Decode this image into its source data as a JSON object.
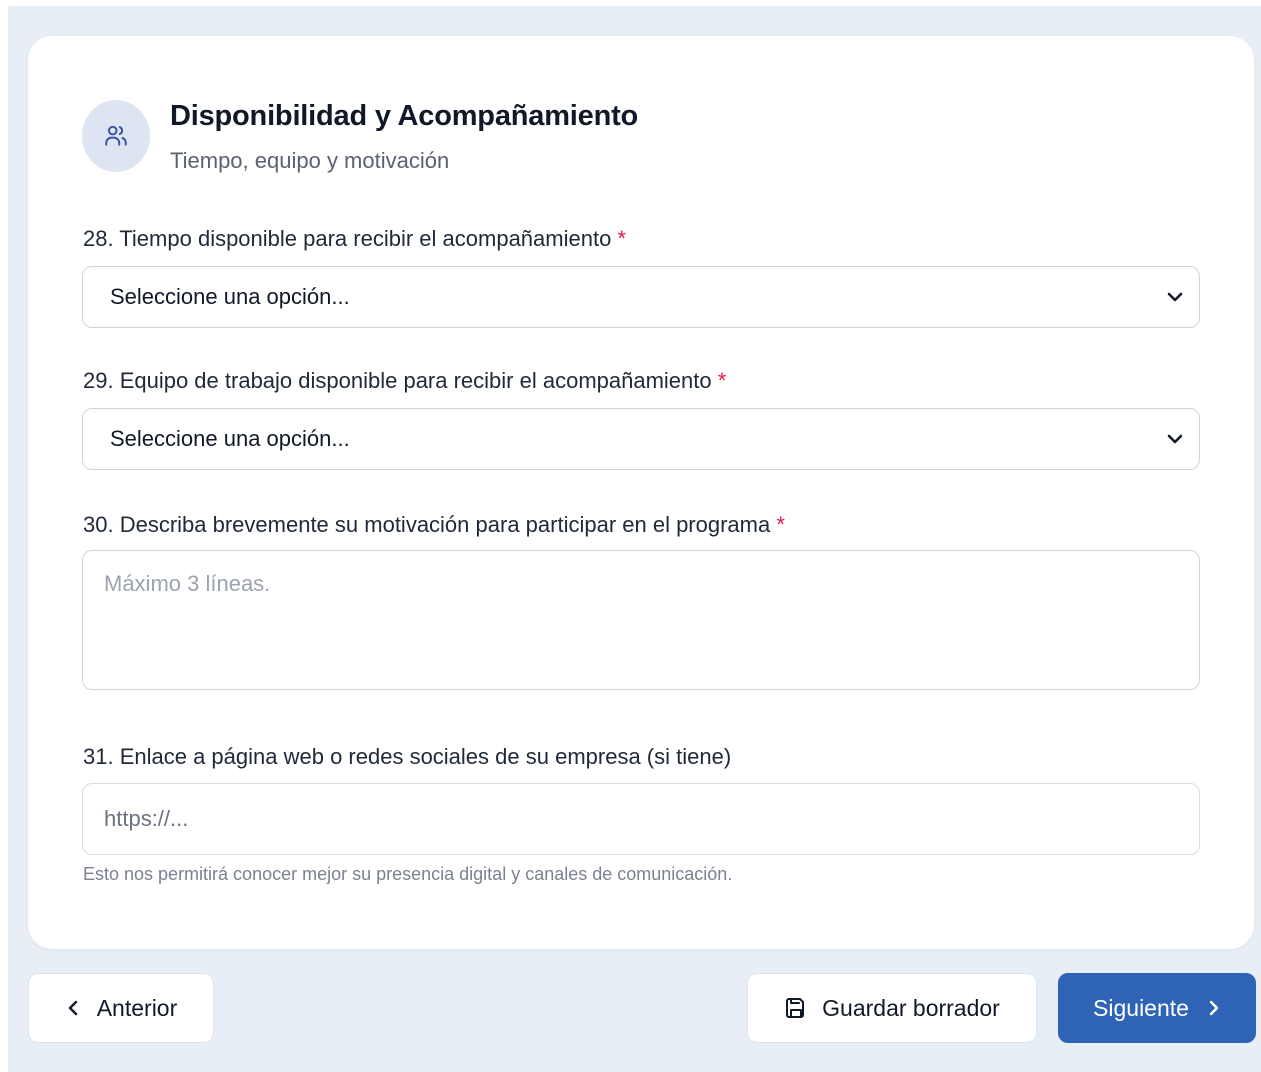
{
  "section": {
    "icon": "users-icon",
    "title": "Disponibilidad y Acompañamiento",
    "subtitle": "Tiempo, equipo y motivación"
  },
  "questions": [
    {
      "label": "28. Tiempo disponible para recibir el acompañamiento",
      "required_mark": "*",
      "type": "select",
      "value": "Seleccione una opción..."
    },
    {
      "label": "29. Equipo de trabajo disponible para recibir el acompañamiento",
      "required_mark": "*",
      "type": "select",
      "value": "Seleccione una opción..."
    },
    {
      "label": "30. Describa brevemente su motivación para participar en el programa",
      "required_mark": "*",
      "type": "textarea",
      "placeholder": "Máximo 3 líneas."
    },
    {
      "label": "31. Enlace a página web o redes sociales de su empresa (si tiene)",
      "type": "text",
      "placeholder": "https://...",
      "hint": "Esto nos permitirá conocer mejor su presencia digital y canales de comunicación."
    }
  ],
  "footer": {
    "prev_label": "Anterior",
    "draft_label": "Guardar borrador",
    "next_label": "Siguiente"
  },
  "colors": {
    "background": "#e8eef6",
    "primary": "#2f63b5",
    "required": "#e11d48",
    "icon_bg": "#dde5f3"
  }
}
